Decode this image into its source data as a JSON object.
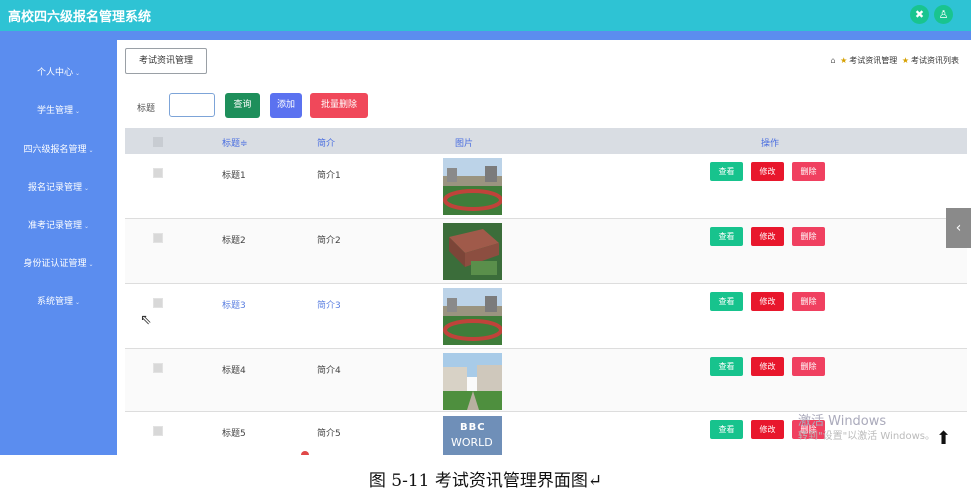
{
  "app": {
    "title": "高校四六级报名管理系统"
  },
  "top_icons": [
    "expand-icon",
    "user-icon"
  ],
  "sidebar": {
    "items": [
      {
        "label": "个人中心"
      },
      {
        "label": "学生管理"
      },
      {
        "label": "四六级报名管理"
      },
      {
        "label": "报名记录管理"
      },
      {
        "label": "准考记录管理"
      },
      {
        "label": "身份证认证管理"
      },
      {
        "label": "系统管理"
      }
    ]
  },
  "tab": {
    "label": "考试资讯管理"
  },
  "breadcrumb": {
    "item1": "考试资讯管理",
    "item2": "考试资讯列表"
  },
  "search": {
    "label": "标题",
    "value": "",
    "placeholder": ""
  },
  "toolbar": {
    "query": "查询",
    "add": "添加",
    "batch_delete": "批量删除"
  },
  "table": {
    "columns": [
      "标题≑",
      "简介",
      "图片",
      "操作"
    ],
    "rows": [
      {
        "title": "标题1",
        "intro": "简介1",
        "image": "campus-track"
      },
      {
        "title": "标题2",
        "intro": "简介2",
        "image": "campus-aerial"
      },
      {
        "title": "标题3",
        "intro": "简介3",
        "image": "campus-track"
      },
      {
        "title": "标题4",
        "intro": "简介4",
        "image": "campus-buildings"
      },
      {
        "title": "标题5",
        "intro": "简介5",
        "image": "bbc-world-news"
      }
    ],
    "actions": {
      "view": "查看",
      "edit": "修改",
      "delete": "删除"
    }
  },
  "watermark": {
    "line1": "激活 Windows",
    "line2": "转到\"设置\"以激活 Windows。"
  },
  "thumb_text": {
    "bbc": "BBC",
    "world": "WORLD"
  },
  "caption": "图 5-11 考试资讯管理界面图↵",
  "colors": {
    "topbar": "#2ec3d4",
    "sidebar": "#5b8def",
    "query": "#1e8f5b",
    "add": "#5b72f0",
    "batch_delete": "#f0485a",
    "view": "#17c38d",
    "edit": "#e8172c",
    "delete": "#f04060"
  }
}
